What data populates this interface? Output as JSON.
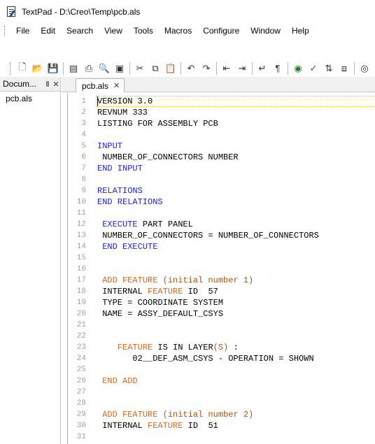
{
  "window": {
    "title": "TextPad - D:\\Creo\\Temp\\pcb.als"
  },
  "menu": [
    "File",
    "Edit",
    "Search",
    "View",
    "Tools",
    "Macros",
    "Configure",
    "Window",
    "Help"
  ],
  "toolbar": {
    "icons": [
      "new-file-icon",
      "open-file-icon",
      "save-icon",
      "sep",
      "save-all-icon",
      "print-icon",
      "print-preview-icon",
      "document-properties-icon",
      "sep",
      "cut-icon",
      "copy-icon",
      "paste-icon",
      "sep",
      "undo-icon",
      "redo-icon",
      "sep",
      "decrease-indent-icon",
      "increase-indent-icon",
      "sep",
      "word-wrap-icon",
      "pilcrow-icon",
      "sep",
      "globe-icon",
      "spell-check-icon",
      "sort-icon",
      "macro-icon",
      "sep",
      "zoom-icon"
    ]
  },
  "document_panel": {
    "title": "Docum...",
    "pin_glyph": "Ⅱ",
    "close_glyph": "✕",
    "files": [
      "pcb.als"
    ]
  },
  "tabs": [
    {
      "label": "pcb.als",
      "close_glyph": "✕"
    }
  ],
  "editor": {
    "current_line": 1,
    "colors": {
      "blue_keyword": "#1f1fcf",
      "orange_keyword": "#d2691e",
      "line_number": "#a0a0a0"
    },
    "lines": [
      {
        "n": "1",
        "text": "VERSION 3.0"
      },
      {
        "n": "2",
        "text": "REVNUM 333"
      },
      {
        "n": "3",
        "text": "LISTING FOR ASSEMBLY PCB"
      },
      {
        "n": "4",
        "text": ""
      },
      {
        "n": "5",
        "text": "INPUT"
      },
      {
        "n": "6",
        "text": " NUMBER_OF_CONNECTORS NUMBER"
      },
      {
        "n": "7",
        "text": "END INPUT"
      },
      {
        "n": "8",
        "text": ""
      },
      {
        "n": "9",
        "text": "RELATIONS"
      },
      {
        "n": "10",
        "text": "END RELATIONS"
      },
      {
        "n": "11",
        "text": ""
      },
      {
        "n": "12",
        "text": " EXECUTE PART PANEL"
      },
      {
        "n": "13",
        "text": " NUMBER_OF_CONNECTORS = NUMBER_OF_CONNECTORS"
      },
      {
        "n": "14",
        "text": " END EXECUTE"
      },
      {
        "n": "15",
        "text": ""
      },
      {
        "n": "16",
        "text": ""
      },
      {
        "n": "17",
        "text": " ADD FEATURE (initial number 1)"
      },
      {
        "n": "18",
        "text": " INTERNAL FEATURE ID  57"
      },
      {
        "n": "19",
        "text": " TYPE = COORDINATE SYSTEM"
      },
      {
        "n": "20",
        "text": " NAME = ASSY_DEFAULT_CSYS"
      },
      {
        "n": "21",
        "text": ""
      },
      {
        "n": "22",
        "text": ""
      },
      {
        "n": "23",
        "text": "    FEATURE IS IN LAYER(S) :"
      },
      {
        "n": "24",
        "text": "       02__DEF_ASM_CSYS - OPERATION = SHOWN"
      },
      {
        "n": "25",
        "text": ""
      },
      {
        "n": "26",
        "text": " END ADD"
      },
      {
        "n": "27",
        "text": ""
      },
      {
        "n": "28",
        "text": ""
      },
      {
        "n": "29",
        "text": " ADD FEATURE (initial number 2)"
      },
      {
        "n": "30",
        "text": " INTERNAL FEATURE ID  51"
      },
      {
        "n": "31",
        "text": ""
      }
    ]
  }
}
